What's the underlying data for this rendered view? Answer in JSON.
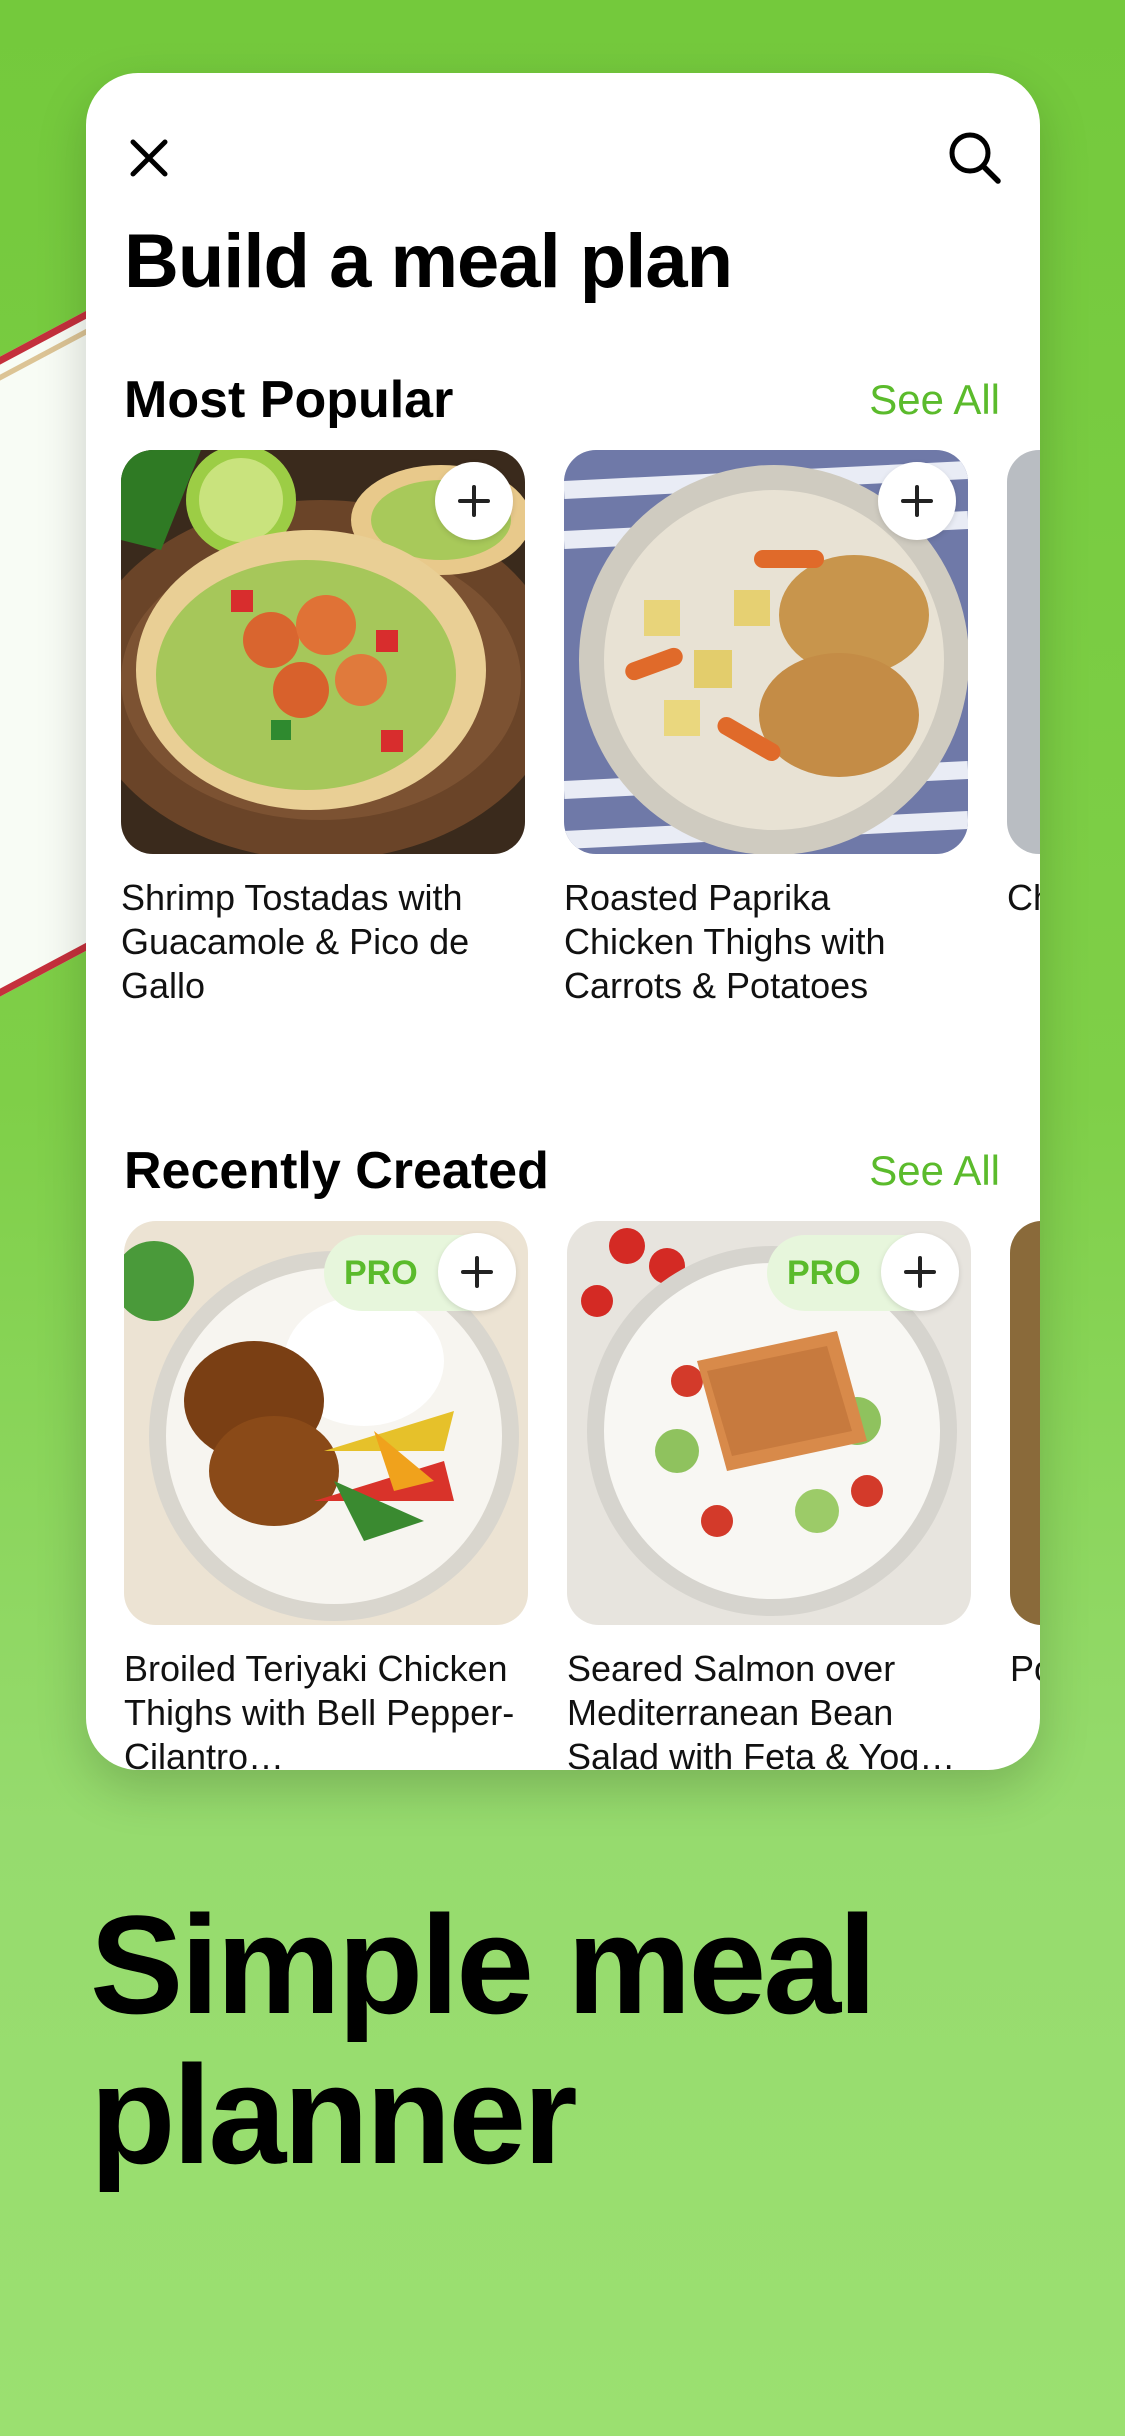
{
  "colors": {
    "accent": "#5bbb2c",
    "background": "#7fcf48",
    "pro_pill": "#e7f6dc"
  },
  "header": {
    "close_icon": "close-icon",
    "search_icon": "search-icon",
    "title": "Build a meal plan"
  },
  "sections": [
    {
      "title": "Most Popular",
      "see_all": "See All",
      "items": [
        {
          "title": "Shrimp Tostadas with Guacamole & Pico de Gallo",
          "pro": false
        },
        {
          "title": "Roasted Paprika Chicken Thighs with Carrots & Potatoes",
          "pro": false
        },
        {
          "title": "Ch Gr Sa",
          "pro": false
        }
      ]
    },
    {
      "title": "Recently Created",
      "see_all": "See All",
      "items": [
        {
          "title": "Broiled Teriyaki Chicken Thighs with Bell Pepper-Cilantro…",
          "pro": true,
          "pro_label": "PRO"
        },
        {
          "title": "Seared Salmon over Mediterranean Bean Salad with Feta & Yog…",
          "pro": true,
          "pro_label": "PRO"
        },
        {
          "title": "Po Bu A",
          "pro": false
        }
      ]
    }
  ],
  "marketing": {
    "headline_line1": "Simple meal",
    "headline_line2": "planner"
  }
}
